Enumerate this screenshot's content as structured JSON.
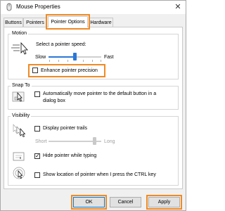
{
  "window": {
    "title": "Mouse Properties"
  },
  "tabs": [
    {
      "label": "Buttons"
    },
    {
      "label": "Pointers"
    },
    {
      "label": "Pointer Options"
    },
    {
      "label": "Hardware"
    }
  ],
  "motion": {
    "group_label": "Motion",
    "speed_label": "Select a pointer speed:",
    "slow_label": "Slow",
    "fast_label": "Fast",
    "speed_level": 0.5,
    "precision_label": "Enhance pointer precision",
    "precision_checked": false
  },
  "snap_to": {
    "group_label": "Snap To",
    "checkbox_label_line1": "Automatically move pointer to the default button in a",
    "checkbox_label_line2": "dialog box",
    "checked": false
  },
  "visibility": {
    "group_label": "Visibility",
    "trails_label": "Display pointer trails",
    "trails_checked": false,
    "short_label": "Short",
    "long_label": "Long",
    "hide_label": "Hide pointer while typing",
    "hide_checked": true,
    "ctrl_label": "Show location of pointer when I press the CTRL key",
    "ctrl_checked": false
  },
  "buttons": {
    "ok": "OK",
    "cancel": "Cancel",
    "apply": "Apply"
  },
  "colors": {
    "accent": "#2a78d6",
    "highlight": "#f08a24"
  }
}
